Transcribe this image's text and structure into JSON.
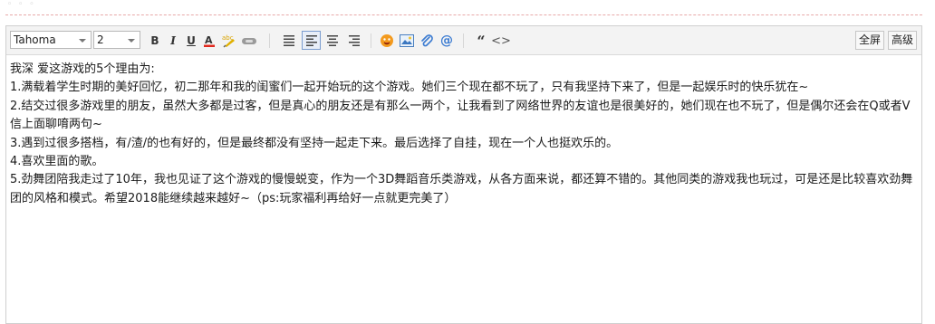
{
  "toolbar": {
    "font_family": "Tahoma",
    "font_size": "2",
    "bold_label": "B",
    "italic_label": "I",
    "underline_label": "U",
    "quote_label": "“",
    "code_label": "<>",
    "fullscreen_label": "全屏",
    "advanced_label": "高级",
    "icons": [
      "bold-icon",
      "italic-icon",
      "underline-icon",
      "font-color-icon",
      "highlight-icon",
      "link-icon",
      "align-left-icon",
      "align-left-active-icon",
      "align-center-icon",
      "align-right-icon",
      "emoji-icon",
      "image-icon",
      "attachment-icon",
      "at-icon",
      "quote-icon",
      "code-icon"
    ]
  },
  "content": {
    "lines": [
      "我深 爱这游戏的5个理由为:",
      "1.满载着学生时期的美好回忆，初二那年和我的闺蜜们一起开始玩的这个游戏。她们三个现在都不玩了，只有我坚持下来了，但是一起娱乐时的快乐犹在~",
      "2.结交过很多游戏里的朋友，虽然大多都是过客，但是真心的朋友还是有那么一两个，让我看到了网络世界的友谊也是很美好的，她们现在也不玩了，但是偶尔还会在Q或者V信上面聊唷两句~",
      "3.遇到过很多搭档，有/渣/的也有好的，但是最终都没有坚持一起走下来。最后选择了自挂，现在一个人也挺欢乐的。",
      "4.喜欢里面的歌。",
      "5.劲舞团陪我走过了10年，我也见证了这个游戏的慢慢蜕变，作为一个3D舞蹈音乐类游戏，从各方面来说，都还算不错的。其他同类的游戏我也玩过，可是还是比较喜欢劲舞团的风格和模式。希望2018能继续越来越好~（ps:玩家福利再给好一点就更完美了）"
    ]
  },
  "colors": {
    "accent": "#3b7bd1",
    "dashed": "#e8a9a9",
    "font_color_bar": "#e0281d"
  }
}
